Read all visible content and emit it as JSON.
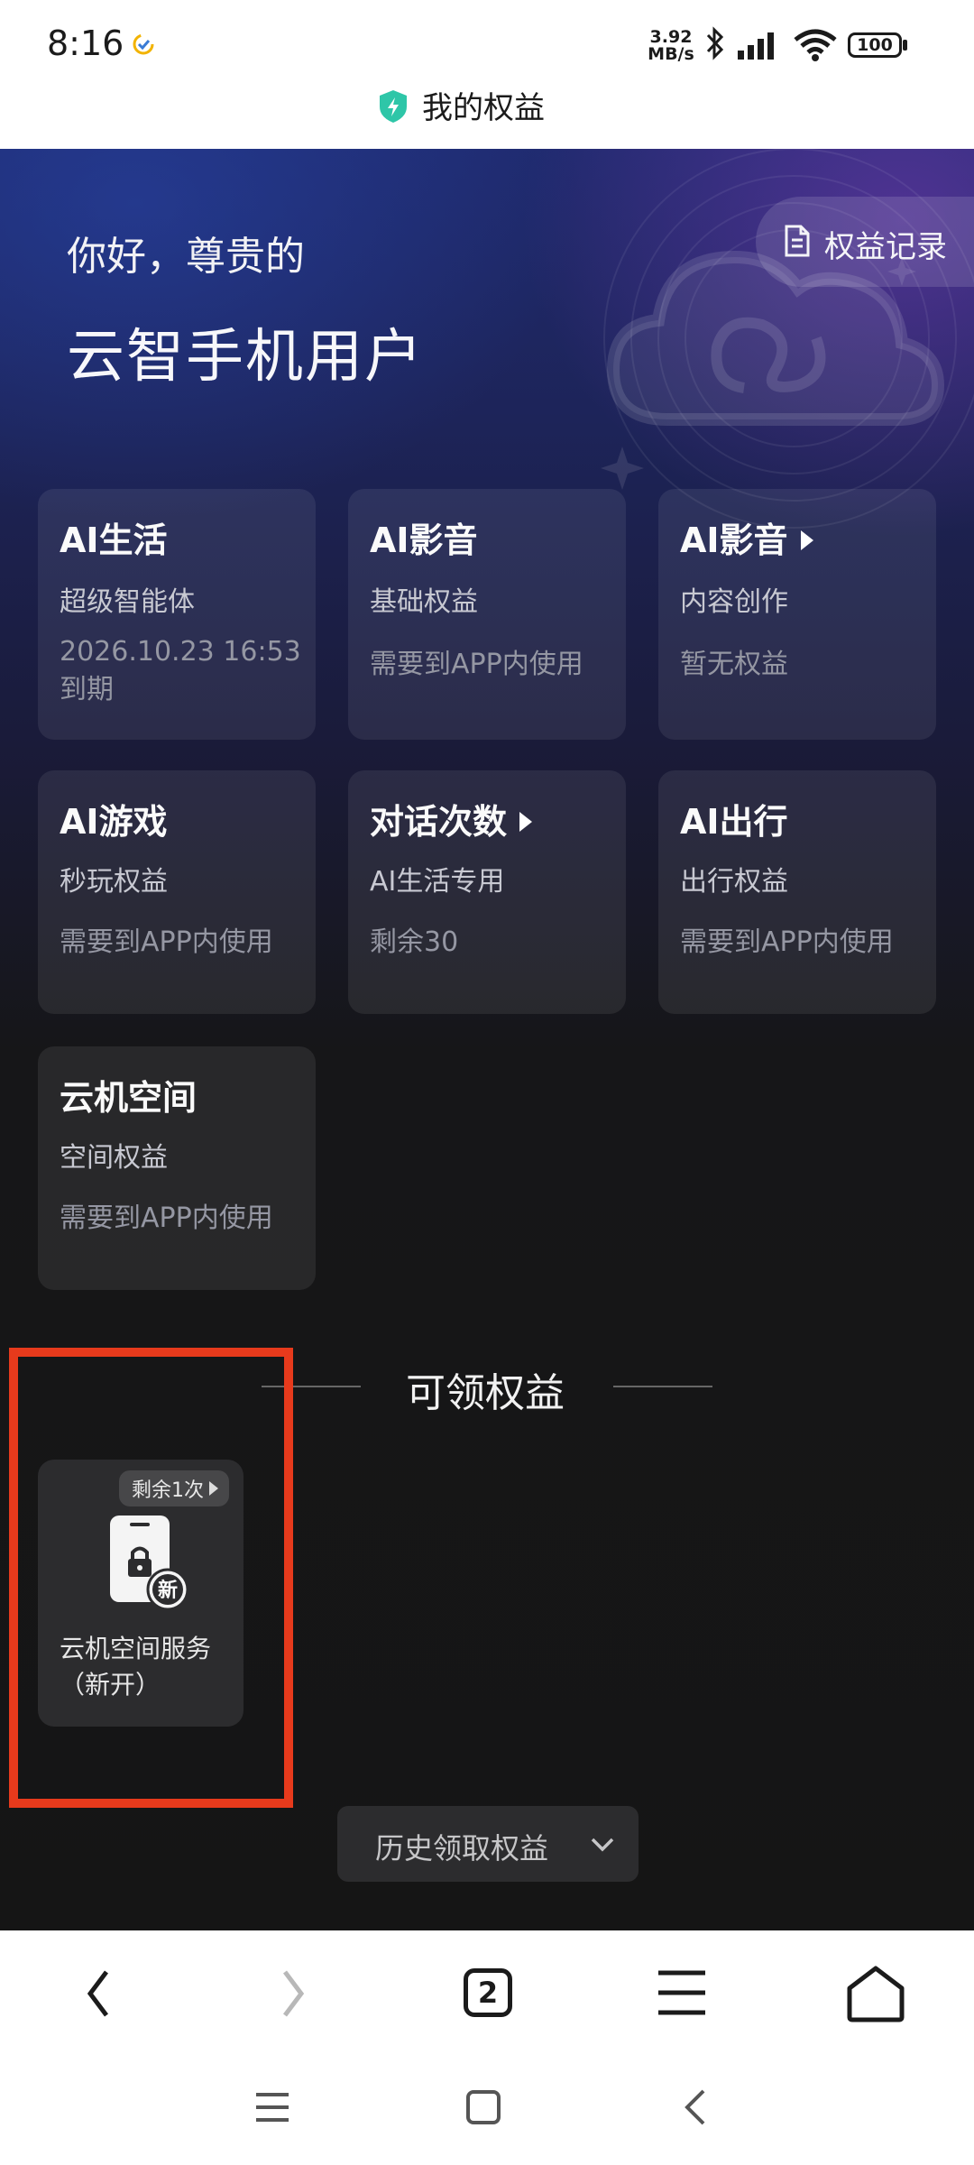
{
  "status_bar": {
    "time": "8:16",
    "net_speed_value": "3.92",
    "net_speed_unit": "MB/s",
    "battery": "100"
  },
  "header": {
    "title": "我的权益"
  },
  "greeting": {
    "line1": "你好，尊贵的",
    "line2": "云智手机用户"
  },
  "records_button": {
    "label": "权益记录"
  },
  "benefit_cards": [
    {
      "title": "AI生活",
      "subtitle": "超级智能体",
      "status": "2026.10.23 16:53 到期",
      "arrow": false
    },
    {
      "title": "AI影音",
      "subtitle": "基础权益",
      "status": "需要到APP内使用",
      "arrow": false
    },
    {
      "title": "AI影音",
      "subtitle": "内容创作",
      "status": "暂无权益",
      "arrow": true
    },
    {
      "title": "AI游戏",
      "subtitle": "秒玩权益",
      "status": "需要到APP内使用",
      "arrow": false
    },
    {
      "title": "对话次数",
      "subtitle": "AI生活专用",
      "status": "剩余30",
      "arrow": true
    },
    {
      "title": "AI出行",
      "subtitle": "出行权益",
      "status": "需要到APP内使用",
      "arrow": false
    },
    {
      "title": "云机空间",
      "subtitle": "空间权益",
      "status": "需要到APP内使用",
      "arrow": false
    }
  ],
  "claimable": {
    "section_title": "可领权益",
    "items": [
      {
        "badge": "剩余1次",
        "icon_badge": "新",
        "name": "云机空间服务（新开）"
      }
    ]
  },
  "history_button": {
    "label": "历史领取权益"
  },
  "browser_nav": {
    "tab_count": "2"
  },
  "colors": {
    "highlight": "#e73a1c",
    "accent_shield": "#2ec6a8"
  }
}
